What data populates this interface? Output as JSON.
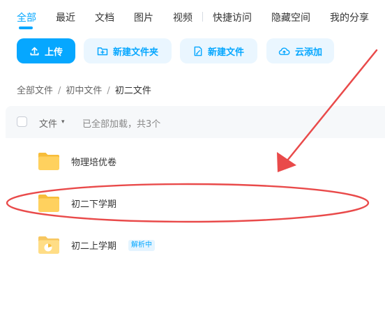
{
  "tabs": [
    {
      "label": "全部",
      "active": true
    },
    {
      "label": "最近"
    },
    {
      "label": "文档"
    },
    {
      "label": "图片"
    },
    {
      "label": "视频"
    },
    {
      "label": "快捷访问"
    },
    {
      "label": "隐藏空间"
    },
    {
      "label": "我的分享"
    }
  ],
  "toolbar": {
    "upload_label": "上传",
    "new_folder_label": "新建文件夹",
    "new_file_label": "新建文件",
    "cloud_add_label": "云添加"
  },
  "breadcrumb": {
    "items": [
      "全部文件",
      "初中文件",
      "初二文件"
    ],
    "separator": "/"
  },
  "list_header": {
    "column_label": "文件",
    "sort_icon": "▾",
    "status_text": "已全部加载，共3个"
  },
  "files": [
    {
      "name": "物理培优卷",
      "icon": "folder-icon"
    },
    {
      "name": "初二下学期",
      "icon": "folder-icon",
      "highlighted": true
    },
    {
      "name": "初二上学期",
      "icon": "folder-sync-icon",
      "badge": "解析中"
    }
  ],
  "colors": {
    "accent": "#06a7ff",
    "annotation": "#e94a4a",
    "folder": "#ffd15e"
  }
}
